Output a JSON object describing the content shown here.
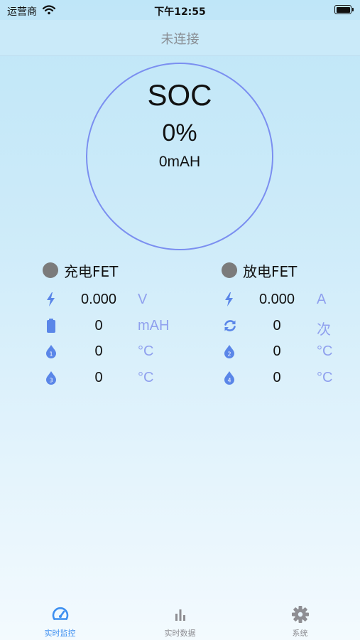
{
  "status_bar": {
    "carrier": "运营商",
    "time": "下午12:55",
    "battery_level": 1.0
  },
  "nav": {
    "title": "未连接"
  },
  "soc": {
    "label": "SOC",
    "percent": "0%",
    "capacity": "0mAH"
  },
  "fets": {
    "charge_label": "充电FET",
    "discharge_label": "放电FET",
    "indicator_color": "#7b7b7b"
  },
  "left_rows": [
    {
      "icon": "lightning-icon",
      "value": "0.000",
      "unit": "V"
    },
    {
      "icon": "battery-icon",
      "value": "0",
      "unit": "mAH"
    },
    {
      "icon": "temperature-1-icon",
      "value": "0",
      "unit": "°C"
    },
    {
      "icon": "temperature-3-icon",
      "value": "0",
      "unit": "°C"
    }
  ],
  "right_rows": [
    {
      "icon": "lightning-icon",
      "value": "0.000",
      "unit": "A"
    },
    {
      "icon": "cycle-icon",
      "value": "0",
      "unit": "次"
    },
    {
      "icon": "temperature-2-icon",
      "value": "0",
      "unit": "°C"
    },
    {
      "icon": "temperature-4-icon",
      "value": "0",
      "unit": "°C"
    }
  ],
  "tabs": [
    {
      "label": "实时监控",
      "icon": "gauge-icon",
      "active": true
    },
    {
      "label": "实时数据",
      "icon": "bar-chart-icon",
      "active": false
    },
    {
      "label": "系统",
      "icon": "gear-icon",
      "active": false
    }
  ],
  "colors": {
    "accent": "#3d8ff0",
    "ring": "#7b8ff0",
    "unit": "#8fa0ee",
    "icon": "#5a86e8",
    "tab_inactive": "#8e8e93"
  }
}
